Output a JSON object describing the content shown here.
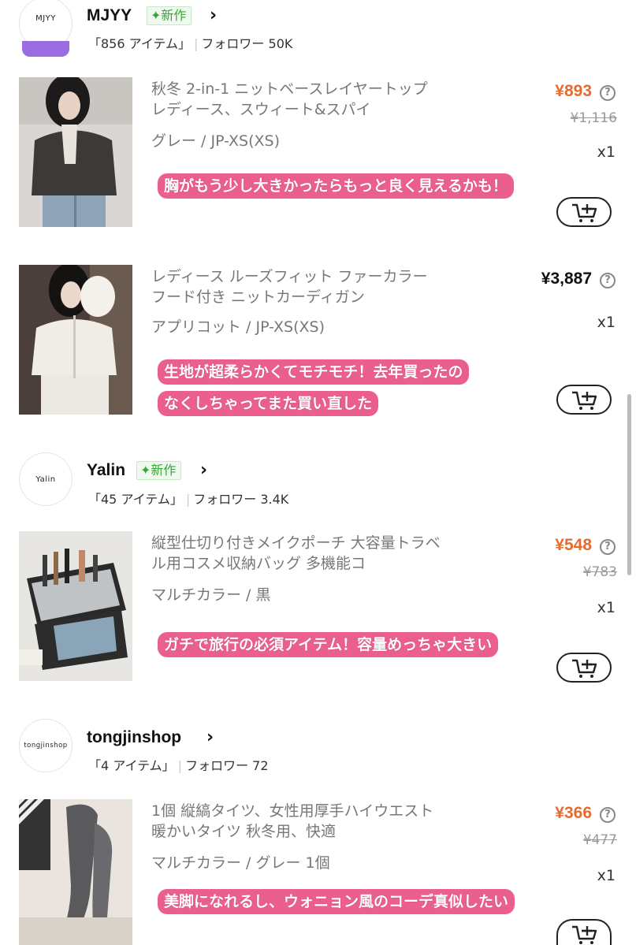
{
  "shops": [
    {
      "logo_text": "MJYY",
      "name": "MJYY",
      "badge": "✦新作",
      "items_count": "「856 アイテム」",
      "followers": "フォロワー 50K"
    },
    {
      "logo_text": "Yalin",
      "name": "Yalin",
      "badge": "✦新作",
      "items_count": "「45 アイテム」",
      "followers": "フォロワー 3.4K"
    },
    {
      "logo_text": "tongjinshop",
      "name": "tongjinshop",
      "items_count": "「4 アイテム」",
      "followers": "フォロワー 72"
    }
  ],
  "products": [
    {
      "title": "秋冬 2-in-1 ニットベースレイヤートップ レディース、スウィート&スパイ",
      "variant": "グレー / JP-XS(XS)",
      "price": "¥893",
      "original_price": "¥1,116",
      "quantity": "x1",
      "note_lines": [
        "胸がもう少し大きかったらもっと良く見えるかも！"
      ],
      "thumb_desc": "gray knit cardigan photo"
    },
    {
      "title": "レディース ルーズフィット ファーカラー フード付き ニットカーディガン",
      "variant": "アプリコット / JP-XS(XS)",
      "price": "¥3,887",
      "quantity": "x1",
      "note_lines": [
        "生地が超柔らかくてモチモチ！去年買ったの",
        "なくしちゃってまた買い直した"
      ],
      "thumb_desc": "white fur hood cardigan photo"
    },
    {
      "title": "縦型仕切り付きメイクポーチ 大容量トラベル用コスメ収納バッグ 多機能コ",
      "variant": "マルチカラー / 黒",
      "price": "¥548",
      "original_price": "¥783",
      "quantity": "x1",
      "note_lines": [
        "ガチで旅行の必須アイテム！容量めっちゃ大きい"
      ],
      "thumb_desc": "makeup pouch photo"
    },
    {
      "title": "1個 縦縞タイツ、女性用厚手ハイウエスト 暖かいタイツ 秋冬用、快適",
      "variant": "マルチカラー / グレー 1個",
      "price": "¥366",
      "original_price": "¥477",
      "quantity": "x1",
      "note_lines": [
        "美脚になれるし、ウォニョン風のコーデ真似したい"
      ],
      "thumb_desc": "gray tights photo"
    }
  ],
  "colors": {
    "price_accent": "#e86a2c",
    "note_pink": "#ea5f8c",
    "badge_green": "#3aa63a"
  },
  "icons": {
    "help": "question-circle-icon",
    "cart": "add-to-cart-icon",
    "chevron": "chevron-right-icon",
    "badge_spark": "sparkle-icon"
  }
}
